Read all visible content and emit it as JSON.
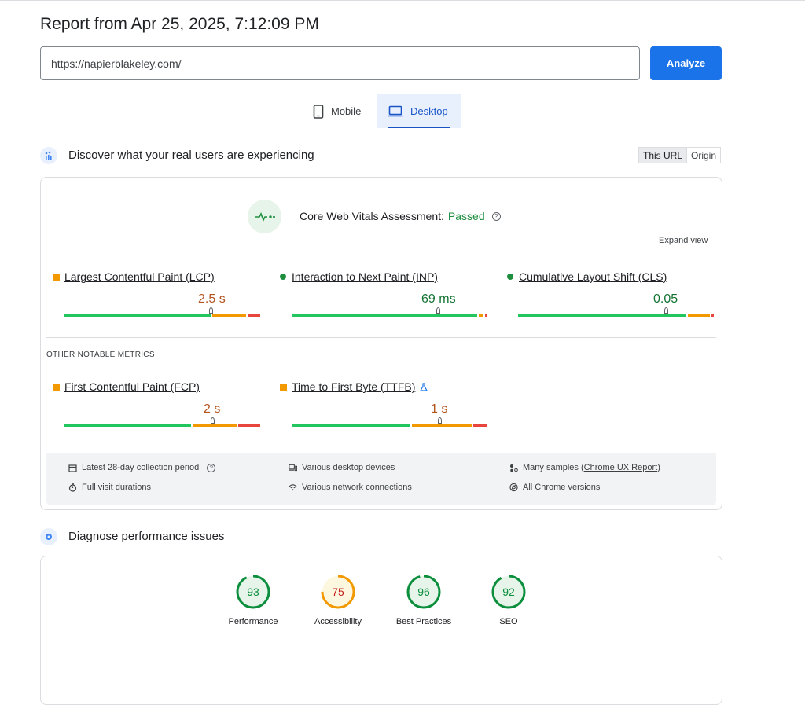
{
  "report": {
    "title": "Report from Apr 25, 2025, 7:12:09 PM"
  },
  "url_input": {
    "value": "https://napierblakeley.com/"
  },
  "analyze_button": {
    "label": "Analyze"
  },
  "tabs": [
    {
      "label": "Mobile",
      "icon": "phone-icon",
      "selected": false
    },
    {
      "label": "Desktop",
      "icon": "laptop-icon",
      "selected": true
    }
  ],
  "field_data": {
    "title": "Discover what your real users are experiencing",
    "toggle": {
      "this_url": "This URL",
      "origin": "Origin",
      "selected": "This URL"
    },
    "assessment": {
      "label": "Core Web Vitals Assessment:",
      "status": "Passed",
      "status_color": "#1e8e3e"
    },
    "expand_view": "Expand view",
    "core_metrics": [
      {
        "name": "Largest Contentful Paint (LCP)",
        "value": "2.5 s",
        "rating": "needs-improvement",
        "distribution": [
          0.75,
          0.18,
          0.07
        ],
        "marker": 0.74
      },
      {
        "name": "Interaction to Next Paint (INP)",
        "value": "69 ms",
        "rating": "good",
        "distribution": [
          0.95,
          0.03,
          0.02
        ],
        "marker": 0.74
      },
      {
        "name": "Cumulative Layout Shift (CLS)",
        "value": "0.05",
        "rating": "good",
        "distribution": [
          0.86,
          0.12,
          0.02
        ],
        "marker": 0.75
      }
    ],
    "other_title": "OTHER NOTABLE METRICS",
    "other_metrics": [
      {
        "name": "First Contentful Paint (FCP)",
        "value": "2 s",
        "rating": "needs-improvement",
        "distribution": [
          0.65,
          0.23,
          0.12
        ],
        "marker": 0.75
      },
      {
        "name": "Time to First Byte (TTFB)",
        "value": "1 s",
        "rating": "needs-improvement",
        "distribution": [
          0.61,
          0.31,
          0.08
        ],
        "marker": 0.75
      }
    ],
    "info": [
      {
        "text": "Latest 28-day collection period",
        "icon": "calendar-icon"
      },
      {
        "text": "Various desktop devices",
        "icon": "devices-icon"
      },
      {
        "text": "Many samples",
        "link": "Chrome UX Report",
        "icon": "samples-icon"
      },
      {
        "text": "Full visit durations",
        "icon": "timer-icon"
      },
      {
        "text": "Various network connections",
        "icon": "wifi-icon"
      },
      {
        "text": "All Chrome versions",
        "icon": "chrome-icon"
      }
    ]
  },
  "lab_data": {
    "title": "Diagnose performance issues",
    "scores": [
      {
        "label": "Performance",
        "score": 93,
        "color": "#0c8f3d",
        "fill": "#e6f4ea"
      },
      {
        "label": "Accessibility",
        "score": 75,
        "color": "#f29900",
        "fill": "#fef7e0"
      },
      {
        "label": "Best Practices",
        "score": 96,
        "color": "#0c8f3d",
        "fill": "#e6f4ea"
      },
      {
        "label": "SEO",
        "score": 92,
        "color": "#0c8f3d",
        "fill": "#e6f4ea"
      }
    ]
  }
}
